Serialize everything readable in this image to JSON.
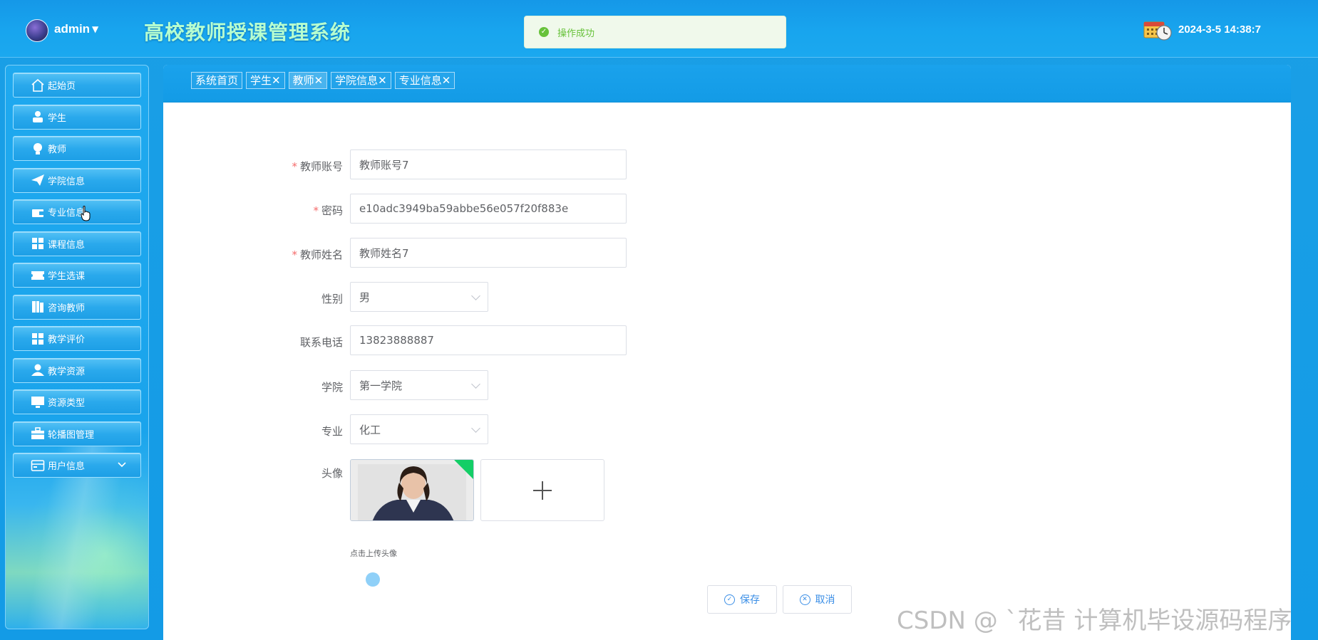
{
  "header": {
    "username": "admin",
    "app_title": "高校教师授课管理系统",
    "toast": "操作成功",
    "datetime": "2024-3-5 14:38:7"
  },
  "sidebar": {
    "items": [
      {
        "label": "起始页",
        "icon": "home-icon"
      },
      {
        "label": "学生",
        "icon": "person-icon"
      },
      {
        "label": "教师",
        "icon": "bulb-icon"
      },
      {
        "label": "学院信息",
        "icon": "paper-plane-icon"
      },
      {
        "label": "专业信息",
        "icon": "wallet-icon"
      },
      {
        "label": "课程信息",
        "icon": "grid-icon"
      },
      {
        "label": "学生选课",
        "icon": "ticket-icon"
      },
      {
        "label": "咨询教师",
        "icon": "book-icon"
      },
      {
        "label": "教学评价",
        "icon": "grid-icon"
      },
      {
        "label": "教学资源",
        "icon": "user-icon"
      },
      {
        "label": "资源类型",
        "icon": "monitor-icon"
      },
      {
        "label": "轮播图管理",
        "icon": "briefcase-icon"
      },
      {
        "label": "用户信息",
        "icon": "card-icon"
      }
    ]
  },
  "tabs": [
    {
      "label": "系统首页"
    },
    {
      "label": "学生✕"
    },
    {
      "label": "教师✕"
    },
    {
      "label": "学院信息✕"
    },
    {
      "label": "专业信息✕"
    }
  ],
  "form": {
    "account_label": "教师账号",
    "account_value": "教师账号7",
    "password_label": "密码",
    "password_value": "e10adc3949ba59abbe56e057f20f883e",
    "name_label": "教师姓名",
    "name_value": "教师姓名7",
    "gender_label": "性别",
    "gender_value": "男",
    "phone_label": "联系电话",
    "phone_value": "13823888887",
    "college_label": "学院",
    "college_value": "第一学院",
    "major_label": "专业",
    "major_value": "化工",
    "avatar_label": "头像",
    "upload_tip": "点击上传头像",
    "save_label": "保存",
    "cancel_label": "取消"
  },
  "watermark": "CSDN @ `花昔 计算机毕设源码程序",
  "colors": {
    "primary_blue": "#139be6",
    "title_green": "#b7ffd0",
    "success_green": "#67c23a",
    "required_red": "#f56c6c",
    "button_blue": "#3a8ee6"
  }
}
